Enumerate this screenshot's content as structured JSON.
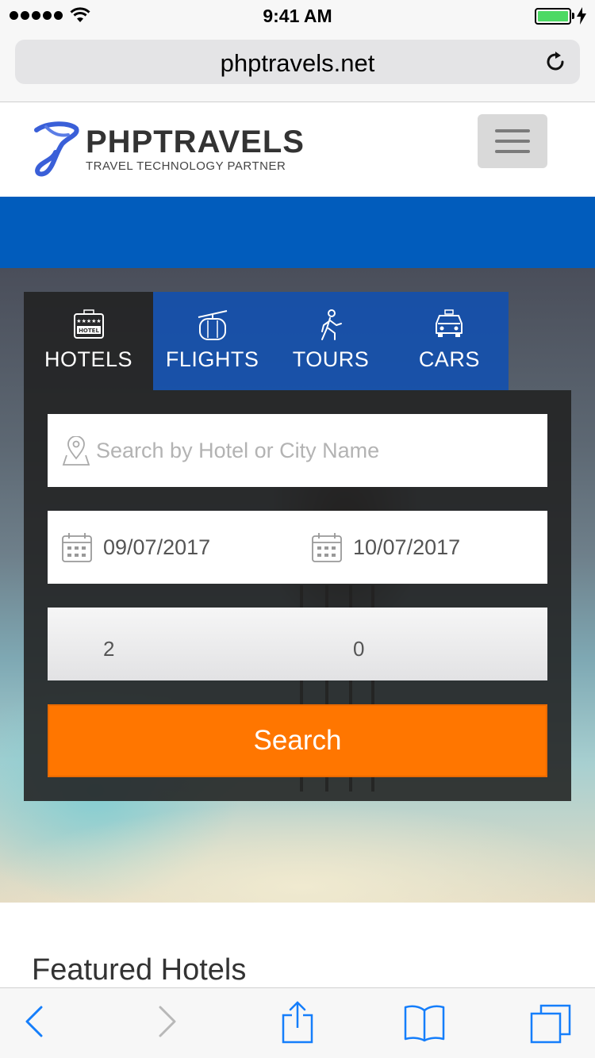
{
  "status_bar": {
    "time": "9:41 AM"
  },
  "browser": {
    "url": "phptravels.net"
  },
  "header": {
    "logo_title": "PHPTRAVELS",
    "logo_tagline": "TRAVEL TECHNOLOGY PARTNER"
  },
  "tabs": [
    {
      "label": "HOTELS",
      "icon": "hotel-icon",
      "active": true
    },
    {
      "label": "FLIGHTS",
      "icon": "flights-icon",
      "active": false
    },
    {
      "label": "TOURS",
      "icon": "tours-icon",
      "active": false
    },
    {
      "label": "CARS",
      "icon": "cars-icon",
      "active": false
    }
  ],
  "search": {
    "location_placeholder": "Search by Hotel or City Name",
    "checkin": "09/07/2017",
    "checkout": "10/07/2017",
    "adults": "2",
    "children": "0",
    "button_label": "Search"
  },
  "featured": {
    "title": "Featured Hotels"
  },
  "colors": {
    "brand_blue": "#015cbc",
    "tab_blue": "#1150b0",
    "search_orange": "#ff7600",
    "panel_dark": "#212121"
  }
}
